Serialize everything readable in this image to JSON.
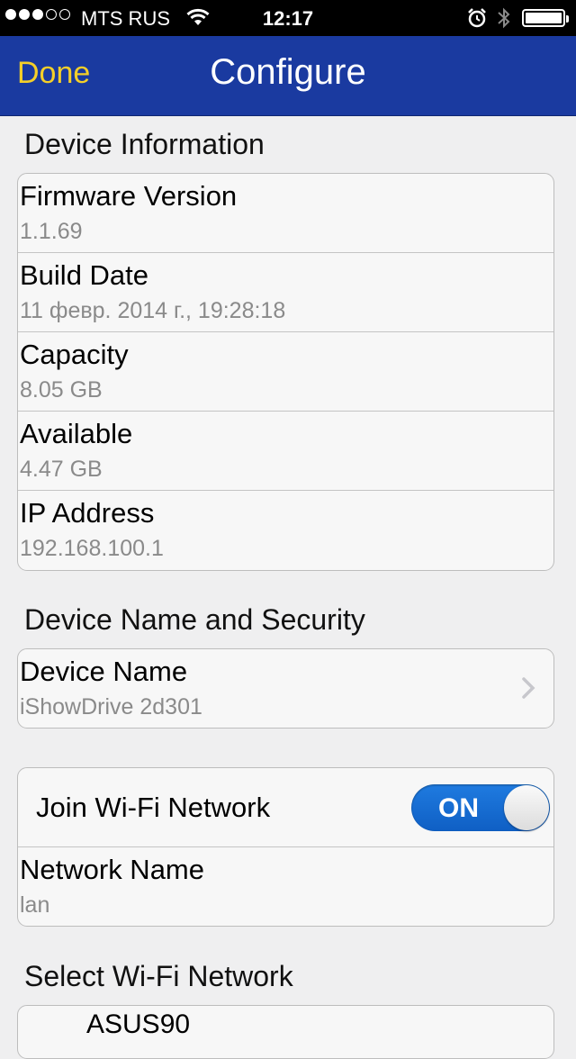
{
  "status_bar": {
    "carrier": "MTS RUS",
    "time": "12:17",
    "signal_dots": [
      true,
      true,
      true,
      false,
      false
    ]
  },
  "nav": {
    "done_label": "Done",
    "title": "Configure",
    "done_color": "#f4cf29",
    "bar_color": "#1a3aa0"
  },
  "device_info": {
    "header": "Device Information",
    "items": [
      {
        "label": "Firmware Version",
        "value": "1.1.69"
      },
      {
        "label": "Build Date",
        "value": "11 февр. 2014 г., 19:28:18"
      },
      {
        "label": "Capacity",
        "value": "8.05 GB"
      },
      {
        "label": "Available",
        "value": "4.47 GB"
      },
      {
        "label": "IP Address",
        "value": "192.168.100.1"
      }
    ]
  },
  "name_security": {
    "header": "Device Name and Security",
    "device_name_label": "Device Name",
    "device_name_value": "iShowDrive 2d301"
  },
  "wifi": {
    "join_label": "Join Wi-Fi Network",
    "toggle_state": "ON",
    "network_name_label": "Network Name",
    "network_name_value": "lan"
  },
  "select_wifi": {
    "header": "Select Wi-Fi Network",
    "first_network_partial": "ASUS90"
  }
}
